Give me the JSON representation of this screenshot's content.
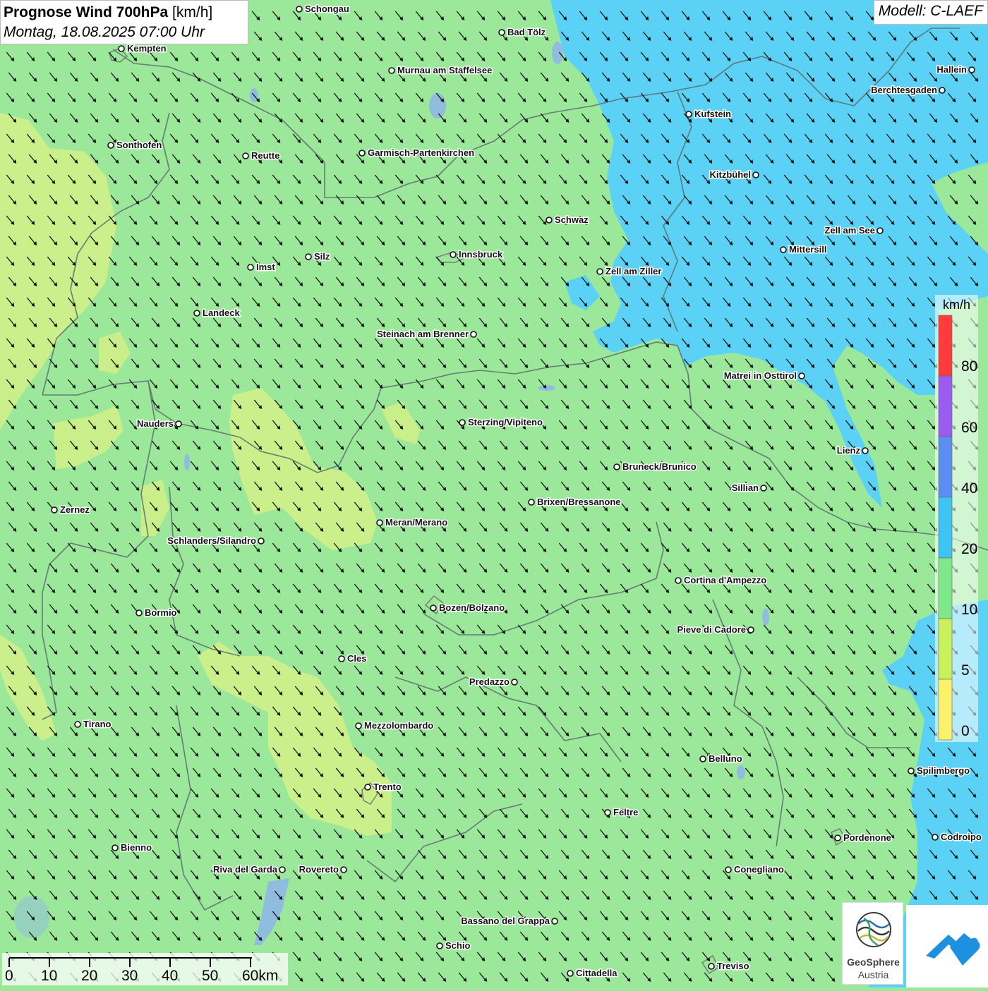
{
  "title": {
    "bold": "Prognose Wind 700hPa",
    "unit": " [km/h]",
    "date": "Montag, 18.08.2025 07:00 Uhr"
  },
  "model": "Modell: C-LAEF",
  "legend": {
    "unit": "km/h",
    "labels": [
      "80",
      "60",
      "40",
      "20",
      "10",
      "5",
      "0"
    ],
    "colors": [
      "#ff3b3b",
      "#9a5cf0",
      "#5b8ef0",
      "#3ec3f5",
      "#7ee88a",
      "#c9f25a",
      "#fbf26a"
    ]
  },
  "scalebar": {
    "labels": [
      "0",
      "10",
      "20",
      "30",
      "40",
      "50",
      "60km"
    ]
  },
  "logos": {
    "geosphere_line1": "GeoSphere",
    "geosphere_line2": "Austria"
  },
  "colors": {
    "wind_10_20": "#9be89b",
    "wind_5_10": "#cdf08a",
    "wind_20_40": "#5bd2f5",
    "border": "#5a6a6a",
    "lake": "#8fb8e6",
    "arrow": "#111111"
  },
  "wind_direction": "from northwest (arrows pointing southeast)",
  "cities": [
    {
      "name": "Schongau"
    },
    {
      "name": "Bad Tölz"
    },
    {
      "name": "Kempten"
    },
    {
      "name": "Murnau am Staffelsee"
    },
    {
      "name": "Hallein"
    },
    {
      "name": "Berchtesgaden"
    },
    {
      "name": "Kufstein"
    },
    {
      "name": "Sonthofen"
    },
    {
      "name": "Reutte"
    },
    {
      "name": "Garmisch-Partenkirchen"
    },
    {
      "name": "Kitzbühel"
    },
    {
      "name": "Schwaz"
    },
    {
      "name": "Zell am See"
    },
    {
      "name": "Mittersill"
    },
    {
      "name": "Innsbruck"
    },
    {
      "name": "Silz"
    },
    {
      "name": "Imst"
    },
    {
      "name": "Zell am Ziller"
    },
    {
      "name": "Landeck"
    },
    {
      "name": "Steinach am Brenner"
    },
    {
      "name": "Matrei in Osttirol"
    },
    {
      "name": "Nauders"
    },
    {
      "name": "Sterzing/Vipiteno"
    },
    {
      "name": "Lienz"
    },
    {
      "name": "Bruneck/Brunico"
    },
    {
      "name": "Sillian"
    },
    {
      "name": "Zernez"
    },
    {
      "name": "Brixen/Bressanone"
    },
    {
      "name": "Meran/Merano"
    },
    {
      "name": "Schlanders/Silandro"
    },
    {
      "name": "Cortina d'Ampezzo"
    },
    {
      "name": "Bozen/Bolzano"
    },
    {
      "name": "Bormio"
    },
    {
      "name": "Pieve di Cadore"
    },
    {
      "name": "Cles"
    },
    {
      "name": "Predazzo"
    },
    {
      "name": "Tirano"
    },
    {
      "name": "Mezzolombardo"
    },
    {
      "name": "Belluno"
    },
    {
      "name": "Spilimbergo"
    },
    {
      "name": "Trento"
    },
    {
      "name": "Feltre"
    },
    {
      "name": "Bienno"
    },
    {
      "name": "Pordenone"
    },
    {
      "name": "Codroipo"
    },
    {
      "name": "Riva del Garda"
    },
    {
      "name": "Rovereto"
    },
    {
      "name": "Conegliano"
    },
    {
      "name": "Bassano del Grappa"
    },
    {
      "name": "Schio"
    },
    {
      "name": "Treviso"
    },
    {
      "name": "Cittadella"
    }
  ]
}
